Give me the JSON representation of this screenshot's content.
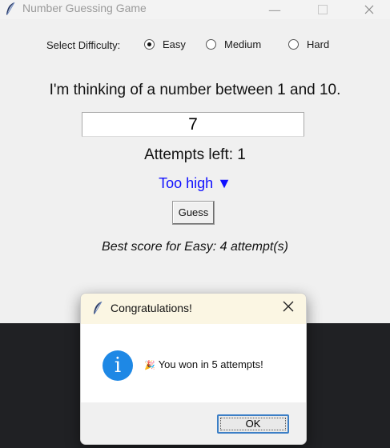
{
  "window": {
    "title": "Number Guessing Game"
  },
  "difficulty": {
    "label": "Select Difficulty:",
    "options": [
      "Easy",
      "Medium",
      "Hard"
    ],
    "selected": "Easy"
  },
  "game": {
    "prompt": "I'm thinking of a number between 1 and 10.",
    "guess_value": "7",
    "attempts_text": "Attempts left: 1",
    "feedback": "Too high ▼",
    "feedback_color": "#1010ff",
    "guess_button": "Guess",
    "best_score": "Best score for Easy: 4 attempt(s)"
  },
  "dialog": {
    "title": "Congratulations!",
    "message": "You won in 5 attempts!",
    "icon": "info-icon",
    "ok_button": "OK"
  },
  "colors": {
    "info_blue": "#1e88e5",
    "dialog_title_bg": "#fbf6e3"
  }
}
